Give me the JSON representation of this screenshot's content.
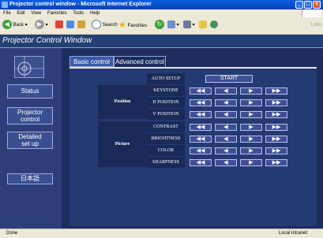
{
  "window": {
    "title": "Projector control window - Microsoft Internet Explorer"
  },
  "menu": [
    "File",
    "Edit",
    "View",
    "Favorites",
    "Tools",
    "Help"
  ],
  "toolbar": {
    "back": "Back",
    "search": "Search",
    "favorites": "Favorites",
    "links": "Links"
  },
  "page": {
    "title": "Projector Control Window"
  },
  "sidebar": {
    "status": "Status",
    "projector_control_1": "Projector",
    "projector_control_2": "control",
    "detailed_setup_1": "Detailed",
    "detailed_setup_2": "set up",
    "language": "日本語"
  },
  "tabs": {
    "basic": "Basic control",
    "advanced": "Advanced control"
  },
  "controls": {
    "auto_setup": "AUTO SETUP",
    "start": "START",
    "position_label": "Position",
    "picture_label": "Picture",
    "position_rows": [
      "KEYSTONE",
      "H POSITION",
      "V POSITION"
    ],
    "picture_rows": [
      "CONTRAST",
      "BRIGHTNESS",
      "COLOR",
      "SHARPNESS"
    ],
    "arrows": [
      "◀◀",
      "◀",
      "▶",
      "▶▶"
    ]
  },
  "statusbar": {
    "left": "Done",
    "right": "Local intranet"
  },
  "colors": {
    "header": "#243f73",
    "sidebar": "#2c3f78",
    "content": "#1c2d5e",
    "button": "#3e4f96"
  }
}
